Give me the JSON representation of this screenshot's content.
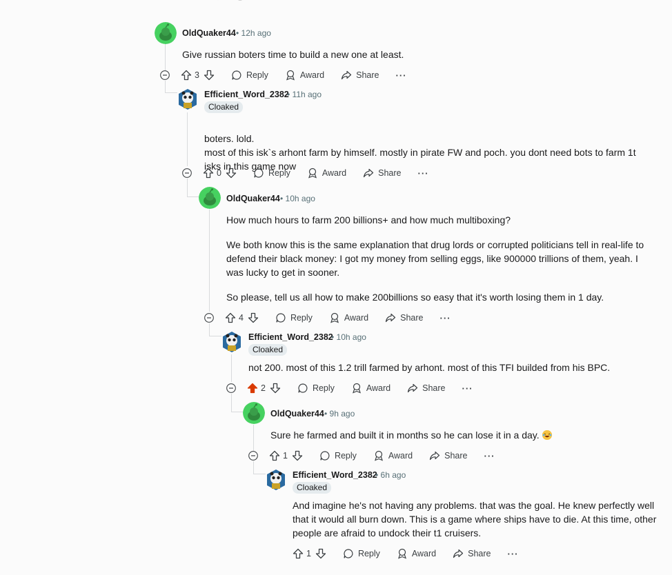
{
  "comments": [
    {
      "author": "OldQuaker44",
      "time": "12h ago",
      "flair": "",
      "paragraphs": [
        "Give russian boters time to build a new one at least."
      ],
      "votes": "3",
      "avatar": "snoo-green"
    },
    {
      "author": "Efficient_Word_2382",
      "time": "11h ago",
      "flair": "Cloaked",
      "paragraphs": [
        "boters. lold.\nmost of this isk`s arhont farm by himself. mostly in pirate FW and poch. you dont need bots to farm 1t isks in this game now"
      ],
      "votes": "0",
      "avatar": "panda-warrior"
    },
    {
      "author": "OldQuaker44",
      "time": "10h ago",
      "flair": "",
      "paragraphs": [
        "How much hours to farm 200 billions+ and how much multiboxing?",
        "We both know this is the same explanation that drug lords or corrupted politicians tell in real-life to defend their black money: I got my money from selling eggs, like 900000 trillions of them, yeah. I was lucky to get in sooner.",
        "So please, tell us all how to make 200billions so easy that it's worth losing them in 1 day."
      ],
      "votes": "4",
      "avatar": "snoo-green"
    },
    {
      "author": "Efficient_Word_2382",
      "time": "10h ago",
      "flair": "Cloaked",
      "paragraphs": [
        "not 200. most of this 1.2 trill farmed by arhont. most of this TFI builded from his BPC."
      ],
      "votes": "2",
      "avatar": "panda-warrior",
      "upvoted": true
    },
    {
      "author": "OldQuaker44",
      "time": "9h ago",
      "flair": "",
      "paragraphs": [
        "Sure he farmed and built it in months so he can lose it in a day."
      ],
      "votes": "1",
      "avatar": "snoo-green",
      "emoji": "laughing-emoji"
    },
    {
      "author": "Efficient_Word_2382",
      "time": "6h ago",
      "flair": "Cloaked",
      "paragraphs": [
        "And imagine he's not having any problems. that was the goal. He knew perfectly well that it would all burn down. This is a game where ships have to die. At this time, other people are afraid to undock their t1 cruisers."
      ],
      "votes": "1",
      "avatar": "panda-warrior"
    }
  ],
  "actions": {
    "reply": "Reply",
    "award": "Award",
    "share": "Share",
    "more": "···"
  },
  "colors": {
    "upvote_active": "#d93a00",
    "thread_line": "#d8dadc",
    "meta": "#576f76"
  }
}
